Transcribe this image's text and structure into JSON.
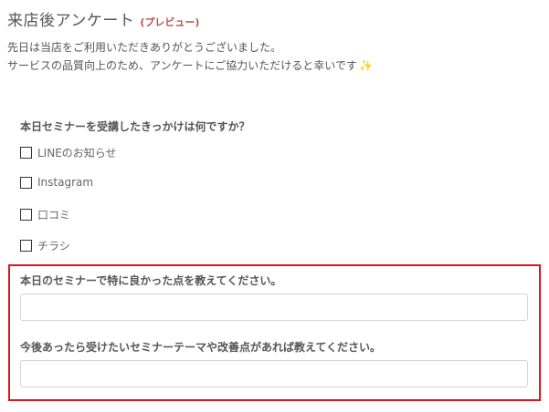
{
  "header": {
    "title": "来店後アンケート",
    "preview_tag": "(プレビュー)"
  },
  "intro": {
    "line1": "先日は当店をご利用いただきありがとうございました。",
    "line2": "サービスの品質向上のため、アンケートにご協力いただけると幸いです",
    "emoji": "✨"
  },
  "question1": {
    "label": "本日セミナーを受講したきっかけは何ですか？",
    "options": [
      {
        "label": "LINEのお知らせ",
        "checked": false
      },
      {
        "label": "Instagram",
        "checked": false
      },
      {
        "label": "口コミ",
        "checked": false
      },
      {
        "label": "チラシ",
        "checked": false
      }
    ]
  },
  "question2": {
    "label": "本日のセミナーで特に良かった点を教えてください。",
    "value": "",
    "placeholder": ""
  },
  "question3": {
    "label": "今後あったら受けたいセミナーテーマや改善点があれば教えてください。",
    "value": "",
    "placeholder": ""
  },
  "colors": {
    "highlight_border": "#e0151b",
    "preview_tag": "#b5524a"
  }
}
